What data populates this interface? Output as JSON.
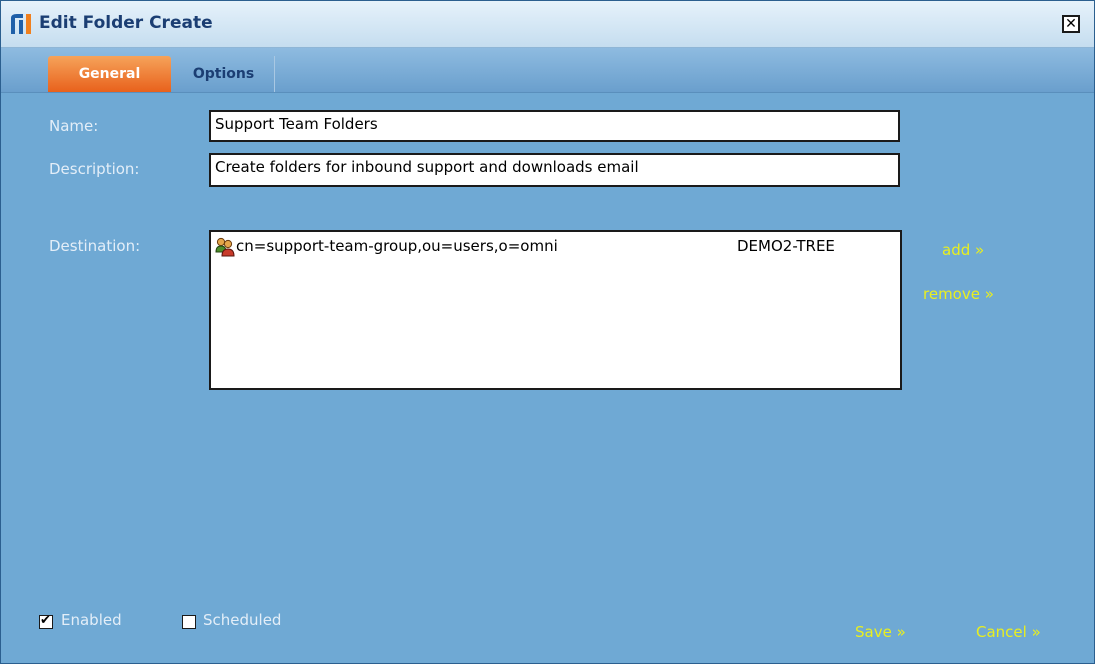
{
  "window": {
    "title": "Edit Folder Create",
    "close_icon": "close-icon"
  },
  "tabs": [
    {
      "label": "General",
      "active": true
    },
    {
      "label": "Options",
      "active": false
    }
  ],
  "form": {
    "name_label": "Name:",
    "name_value": "Support Team Folders",
    "description_label": "Description:",
    "description_value": "Create folders for inbound support and downloads email",
    "destination_label": "Destination:"
  },
  "destinations": [
    {
      "icon": "group-icon",
      "dn": "cn=support-team-group,ou=users,o=omni",
      "tree": "DEMO2-TREE"
    }
  ],
  "actions": {
    "add": "add »",
    "remove": "remove »",
    "save": "Save »",
    "cancel": "Cancel »"
  },
  "options": {
    "enabled_label": "Enabled",
    "enabled_checked": true,
    "scheduled_label": "Scheduled",
    "scheduled_checked": false
  },
  "colors": {
    "background": "#6fa9d4",
    "link": "#e9ef1f",
    "active_tab": "#e8611c"
  }
}
